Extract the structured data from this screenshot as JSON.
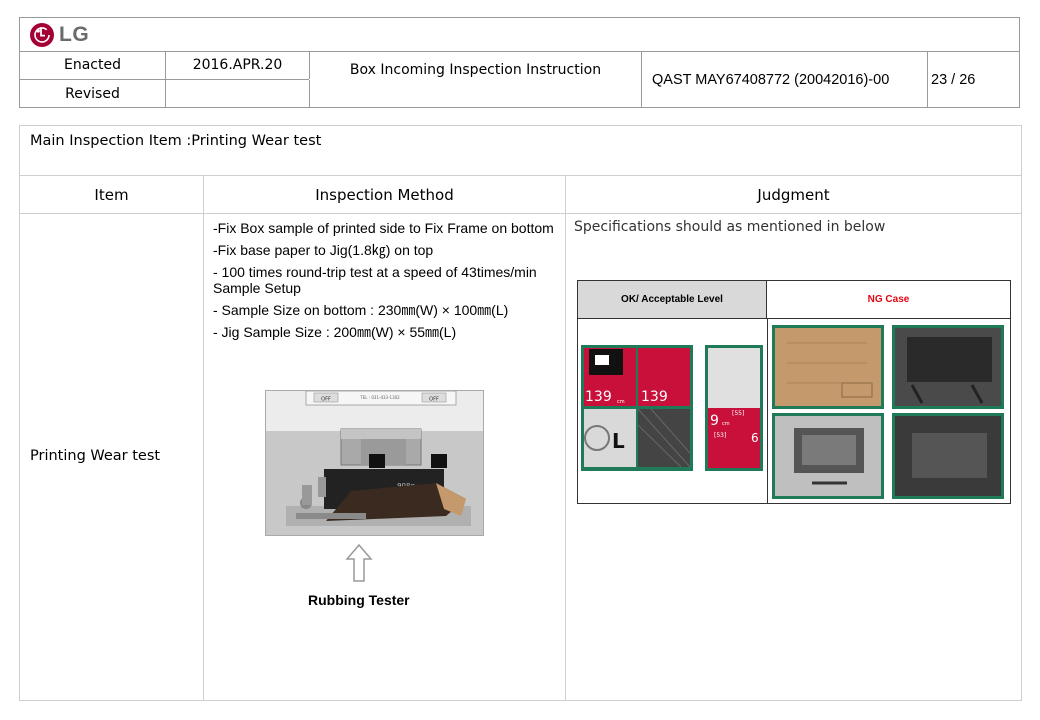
{
  "header": {
    "logo_text": "LG",
    "enacted_label": "Enacted",
    "enacted_value": "2016.APR.20",
    "revised_label": "Revised",
    "revised_value": "",
    "doc_title": "Box Incoming Inspection Instruction",
    "doc_code": "QAST MAY67408772 (20042016)-00",
    "page": "23 / 26"
  },
  "main": {
    "title": "Main Inspection Item :Printing Wear test",
    "col_item": "Item",
    "col_method": "Inspection Method",
    "col_judgment": "Judgment",
    "item_value": "Printing Wear test",
    "method_lines": [
      "-Fix Box sample of printed side to Fix Frame on bottom",
      "-Fix base paper to Jig(1.8㎏) on top",
      "- 100 times round-trip test at a speed of 43times/min Sample Setup",
      "- Sample Size on bottom : 230㎜(W) × 100㎜(L)",
      "- Jig Sample Size : 200㎜(W) × 55㎜(L)"
    ],
    "photo_caption": "Rubbing Tester",
    "photo_texts": {
      "off_left": "OFF",
      "off_right": "OFF",
      "tel": "TEL : 031-433-1302",
      "weight": "908g"
    },
    "judgment_text": "Specifications should as mentioned in below",
    "ok_header": "OK/ Acceptable Level",
    "ng_header": "NG Case",
    "sample_texts": {
      "n1": "139",
      "n2": "139",
      "n3": "9",
      "unit": "cm",
      "s55": "[55]",
      "s53": "[53]",
      "lg1": "L",
      "lg2": "L",
      "d6": "6"
    }
  },
  "colors": {
    "lg_red": "#a50034",
    "ng_red": "#e30613",
    "grid": "#cfcfcf"
  }
}
